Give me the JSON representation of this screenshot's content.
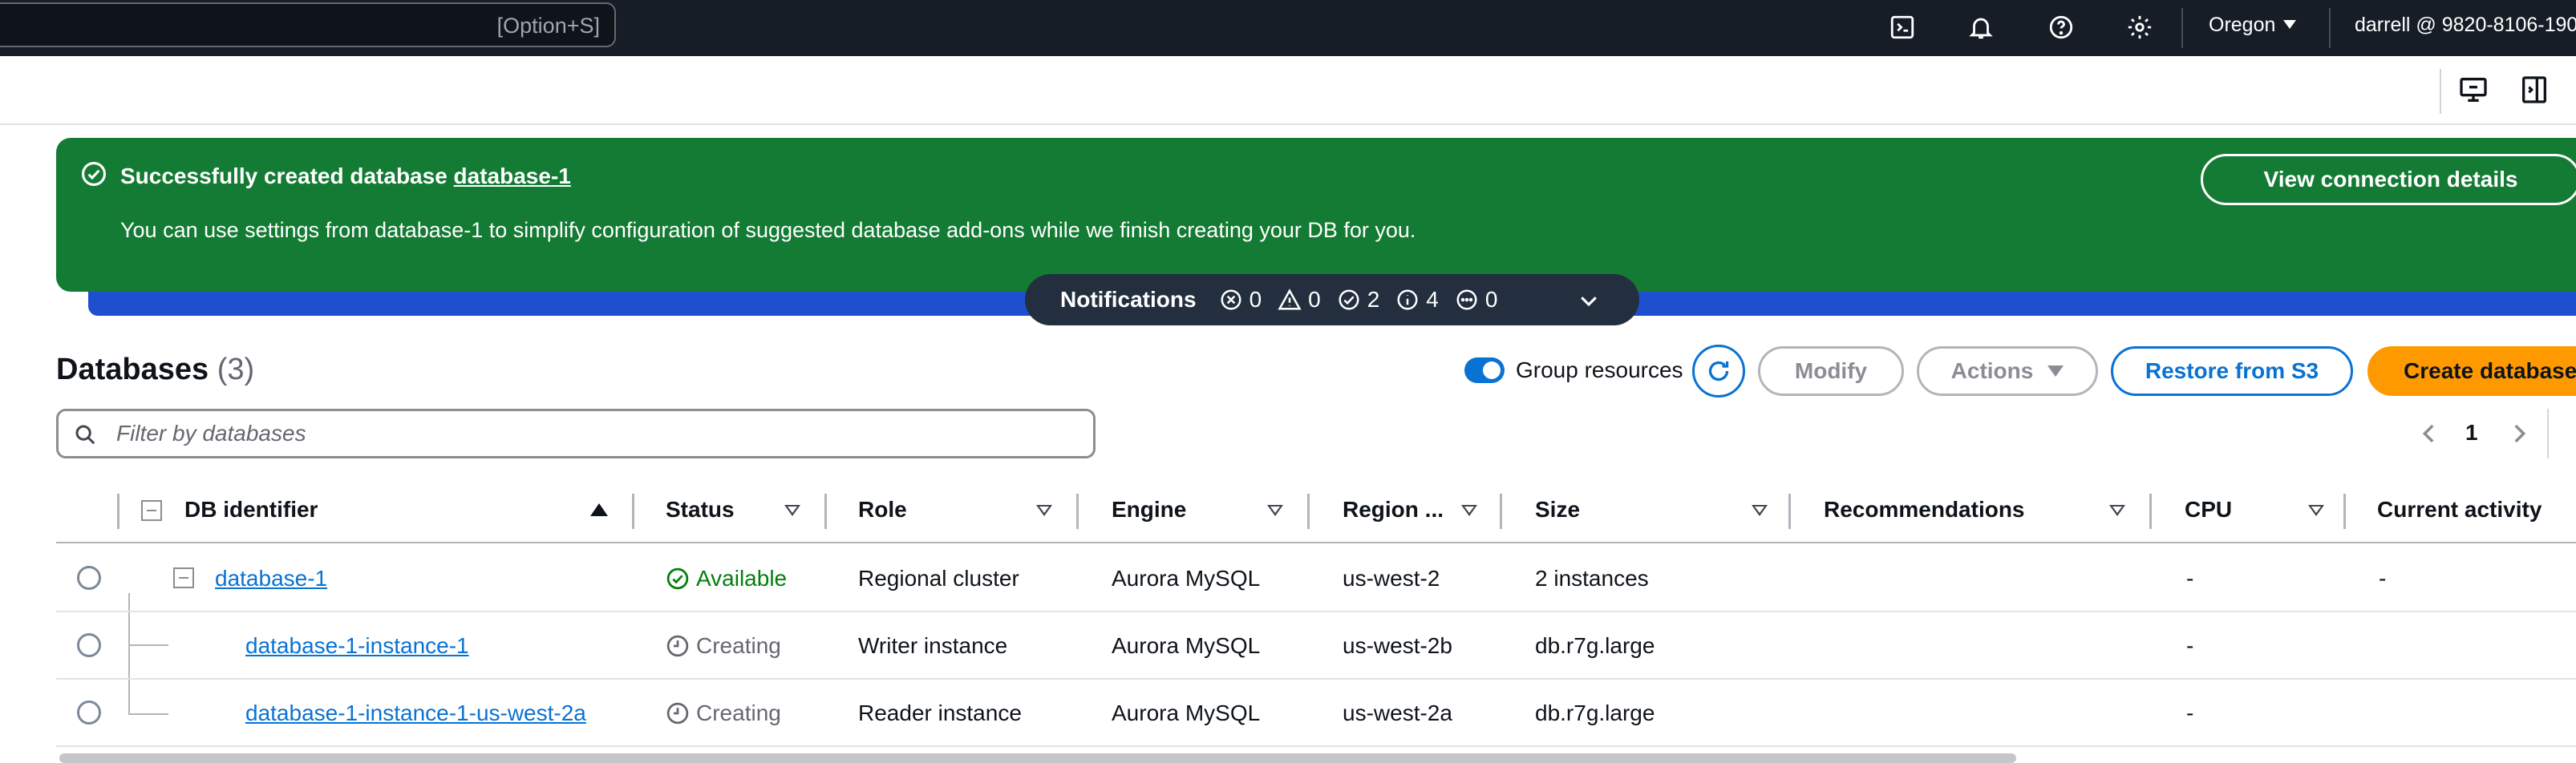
{
  "topnav": {
    "search_shortcut": "[Option+S]",
    "region": "Oregon",
    "account": "darrell @ 9820-8106-190",
    "icons": [
      "cloudshell-icon",
      "bell-icon",
      "help-icon",
      "gear-icon"
    ]
  },
  "toolbar": {
    "icons": [
      "split-panel-icon",
      "tools-panel-icon"
    ]
  },
  "flash": {
    "title_prefix": "Successfully created database",
    "title_link": "database-1",
    "body": "You can use settings from database-1 to simplify configuration of suggested database add-ons while we finish creating your DB for you.",
    "button": "View connection details",
    "colors": {
      "background": "#137b33",
      "underlay": "#1e4fcf"
    }
  },
  "notifications": {
    "label": "Notifications",
    "error": "0",
    "warning": "0",
    "success": "2",
    "info": "4",
    "in_progress": "0"
  },
  "databases": {
    "title": "Databases",
    "count": "(3)",
    "group_resources_label": "Group resources",
    "group_resources_on": true,
    "buttons": {
      "modify": "Modify",
      "actions": "Actions",
      "restore": "Restore from S3",
      "create": "Create database"
    },
    "filter_placeholder": "Filter by databases",
    "page": "1"
  },
  "table": {
    "columns": {
      "db_identifier": "DB identifier",
      "status": "Status",
      "role": "Role",
      "engine": "Engine",
      "region": "Region ...",
      "size": "Size",
      "recommendations": "Recommendations",
      "cpu": "CPU",
      "current_activity": "Current activity"
    },
    "rows": [
      {
        "id": "database-1",
        "status": "Available",
        "role": "Regional cluster",
        "engine": "Aurora MySQL",
        "region": "us-west-2",
        "size": "2 instances",
        "recommendations": "",
        "cpu": "-",
        "activity": "-"
      },
      {
        "id": "database-1-instance-1",
        "status": "Creating",
        "role": "Writer instance",
        "engine": "Aurora MySQL",
        "region": "us-west-2b",
        "size": "db.r7g.large",
        "recommendations": "",
        "cpu": "-",
        "activity": ""
      },
      {
        "id": "database-1-instance-1-us-west-2a",
        "status": "Creating",
        "role": "Reader instance",
        "engine": "Aurora MySQL",
        "region": "us-west-2a",
        "size": "db.r7g.large",
        "recommendations": "",
        "cpu": "-",
        "activity": ""
      }
    ]
  },
  "colors": {
    "accent": "#0972d3",
    "primary_button": "#ff9900",
    "success_text": "#037f0c",
    "nav_bg": "#161d26"
  }
}
